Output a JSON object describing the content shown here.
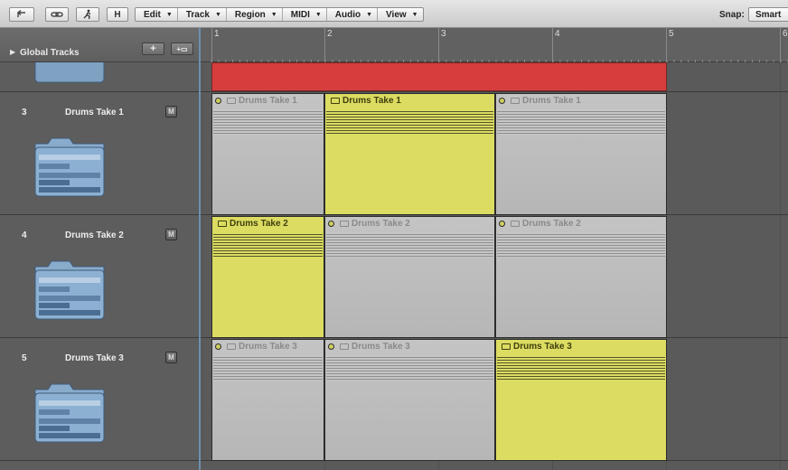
{
  "toolbar": {
    "buttons": [
      {
        "name": "back-button",
        "label": "↰"
      },
      {
        "name": "link-button",
        "label": "⊘"
      },
      {
        "name": "catch-button",
        "label": "🏃"
      },
      {
        "name": "hide-button",
        "label": "H"
      }
    ],
    "menus": [
      "Edit",
      "Track",
      "Region",
      "MIDI",
      "Audio",
      "View"
    ],
    "snap_label": "Snap:",
    "snap_value": "Smart"
  },
  "global_tracks": {
    "label": "Global Tracks",
    "add_button": "+",
    "add_multi_button": "+▭"
  },
  "ruler": {
    "bars": [
      "1",
      "2",
      "3",
      "4",
      "5",
      "6"
    ]
  },
  "tracks": [
    {
      "number": "3",
      "name": "Drums Take 1",
      "mute": "M"
    },
    {
      "number": "4",
      "name": "Drums Take 2",
      "mute": "M"
    },
    {
      "number": "5",
      "name": "Drums Take 3",
      "mute": "M"
    }
  ],
  "regions": {
    "track3": [
      "Drums Take 1",
      "Drums Take 1",
      "Drums Take 1"
    ],
    "track4": [
      "Drums Take 2",
      "Drums Take 2",
      "Drums Take 2"
    ],
    "track5": [
      "Drums Take 3",
      "Drums Take 3",
      "Drums Take 3"
    ]
  },
  "colors": {
    "active_region": "#dcdc62",
    "inactive_region": "#c0c0c0",
    "folder_region": "#d63d3d"
  }
}
